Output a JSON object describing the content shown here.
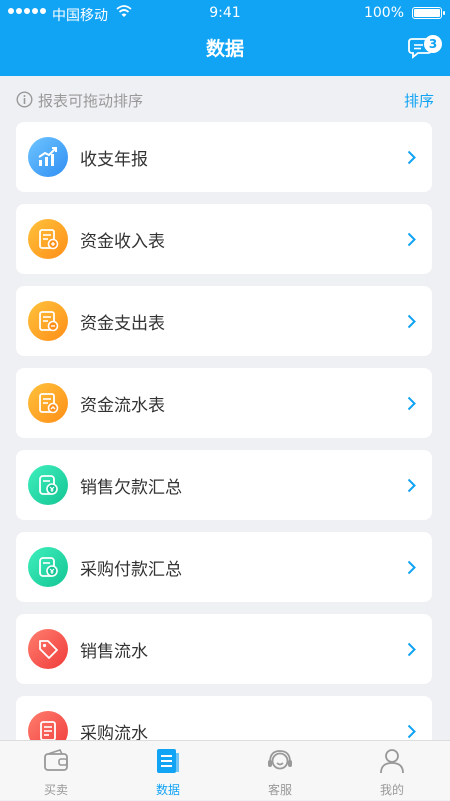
{
  "status": {
    "carrier": "中国移动",
    "time": "9:41",
    "battery": "100%"
  },
  "header": {
    "title": "数据",
    "message_badge": "3"
  },
  "tip": {
    "text": "报表可拖动排序",
    "sort_label": "排序"
  },
  "reports": [
    {
      "label": "收支年报",
      "icon": "chart-trend-icon",
      "color": "blue"
    },
    {
      "label": "资金收入表",
      "icon": "income-sheet-icon",
      "color": "orange"
    },
    {
      "label": "资金支出表",
      "icon": "expense-sheet-icon",
      "color": "orange"
    },
    {
      "label": "资金流水表",
      "icon": "cashflow-sheet-icon",
      "color": "orange"
    },
    {
      "label": "销售欠款汇总",
      "icon": "sales-debt-icon",
      "color": "green"
    },
    {
      "label": "采购付款汇总",
      "icon": "purchase-payment-icon",
      "color": "green"
    },
    {
      "label": "销售流水",
      "icon": "tag-icon",
      "color": "red"
    },
    {
      "label": "采购流水",
      "icon": "receipt-icon",
      "color": "red"
    }
  ],
  "tabs": [
    {
      "label": "买卖",
      "icon": "wallet-icon",
      "active": false
    },
    {
      "label": "数据",
      "icon": "data-doc-icon",
      "active": true
    },
    {
      "label": "客服",
      "icon": "headset-icon",
      "active": false
    },
    {
      "label": "我的",
      "icon": "person-icon",
      "active": false
    }
  ]
}
